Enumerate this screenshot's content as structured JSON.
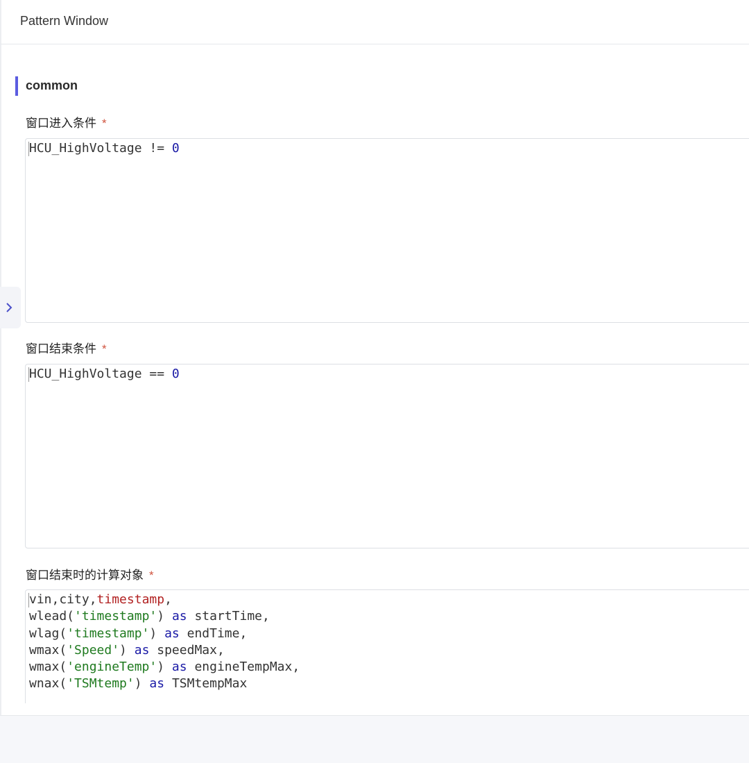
{
  "header": {
    "title": "Pattern Window"
  },
  "section": {
    "title": "common"
  },
  "fields": [
    {
      "label": "窗口进入条件",
      "required": "*",
      "lines": [
        [
          {
            "t": "HCU_HighVoltage != ",
            "c": "plain"
          },
          {
            "t": "0",
            "c": "num"
          }
        ]
      ]
    },
    {
      "label": "窗口结束条件",
      "required": "*",
      "lines": [
        [
          {
            "t": "HCU_HighVoltage == ",
            "c": "plain"
          },
          {
            "t": "0",
            "c": "num"
          }
        ]
      ]
    },
    {
      "label": "窗口结束时的计算对象",
      "required": "*",
      "lines": [
        [
          {
            "t": "vin,city,",
            "c": "plain"
          },
          {
            "t": "timestamp",
            "c": "var"
          },
          {
            "t": ",",
            "c": "plain"
          }
        ],
        [
          {
            "t": "wlead(",
            "c": "plain"
          },
          {
            "t": "'timestamp'",
            "c": "str"
          },
          {
            "t": ") ",
            "c": "plain"
          },
          {
            "t": "as",
            "c": "kw"
          },
          {
            "t": " startTime,",
            "c": "plain"
          }
        ],
        [
          {
            "t": "wlag(",
            "c": "plain"
          },
          {
            "t": "'timestamp'",
            "c": "str"
          },
          {
            "t": ") ",
            "c": "plain"
          },
          {
            "t": "as",
            "c": "kw"
          },
          {
            "t": " endTime,",
            "c": "plain"
          }
        ],
        [
          {
            "t": "wmax(",
            "c": "plain"
          },
          {
            "t": "'Speed'",
            "c": "str"
          },
          {
            "t": ") ",
            "c": "plain"
          },
          {
            "t": "as",
            "c": "kw"
          },
          {
            "t": " speedMax,",
            "c": "plain"
          }
        ],
        [
          {
            "t": "wmax(",
            "c": "plain"
          },
          {
            "t": "'engineTemp'",
            "c": "str"
          },
          {
            "t": ") ",
            "c": "plain"
          },
          {
            "t": "as",
            "c": "kw"
          },
          {
            "t": " engineTempMax,",
            "c": "plain"
          }
        ],
        [
          {
            "t": "wnax(",
            "c": "plain"
          },
          {
            "t": "'TSMtemp'",
            "c": "str"
          },
          {
            "t": ") ",
            "c": "plain"
          },
          {
            "t": "as",
            "c": "kw"
          },
          {
            "t": " TSMtempMax",
            "c": "plain"
          }
        ]
      ]
    }
  ],
  "icons": {
    "expand": "chevron-right-icon"
  },
  "colors": {
    "accent": "#5b5ce0",
    "required": "#d0543f",
    "keyword": "#1a1aa6",
    "string": "#1f7a1f",
    "variable": "#b22222"
  }
}
